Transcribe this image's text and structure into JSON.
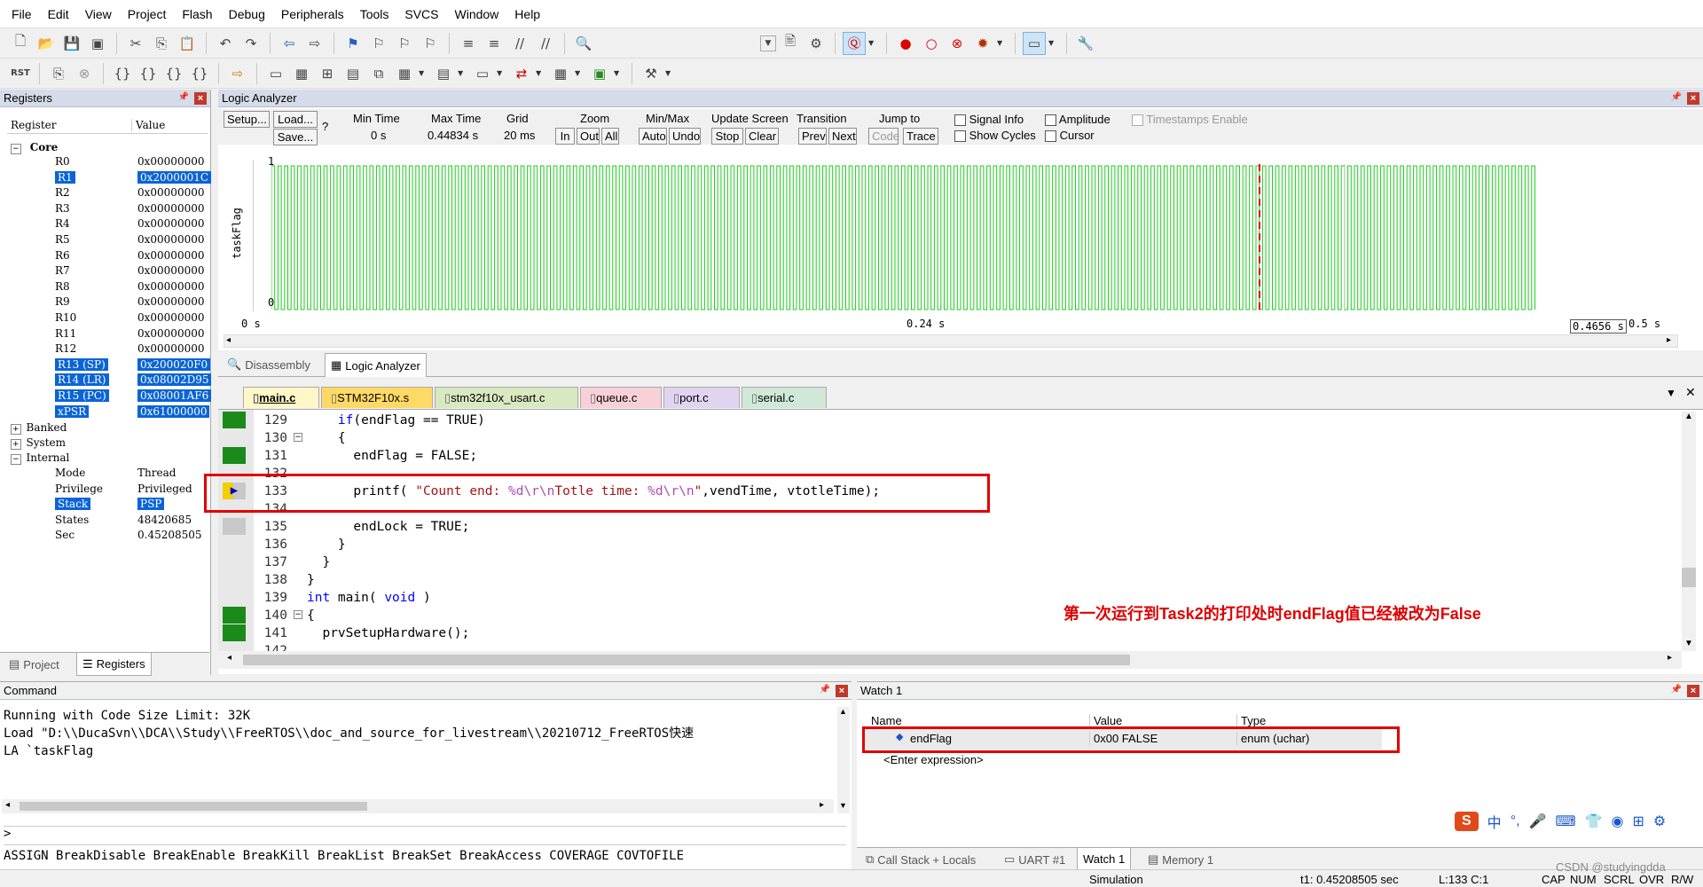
{
  "menu": [
    "File",
    "Edit",
    "View",
    "Project",
    "Flash",
    "Debug",
    "Peripherals",
    "Tools",
    "SVCS",
    "Window",
    "Help"
  ],
  "colors": {
    "accent": "#0a64d6",
    "signal": "#22cc22",
    "red_annotation": "#e00000",
    "panel_header": "#d6dbe9"
  },
  "registers_panel": {
    "title": "Registers",
    "col_register": "Register",
    "col_value": "Value",
    "core_label": "Core",
    "core": [
      {
        "name": "R0",
        "value": "0x00000000",
        "sel": false
      },
      {
        "name": "R1",
        "value": "0x2000001C",
        "sel": true
      },
      {
        "name": "R2",
        "value": "0x00000000",
        "sel": false
      },
      {
        "name": "R3",
        "value": "0x00000000",
        "sel": false
      },
      {
        "name": "R4",
        "value": "0x00000000",
        "sel": false
      },
      {
        "name": "R5",
        "value": "0x00000000",
        "sel": false
      },
      {
        "name": "R6",
        "value": "0x00000000",
        "sel": false
      },
      {
        "name": "R7",
        "value": "0x00000000",
        "sel": false
      },
      {
        "name": "R8",
        "value": "0x00000000",
        "sel": false
      },
      {
        "name": "R9",
        "value": "0x00000000",
        "sel": false
      },
      {
        "name": "R10",
        "value": "0x00000000",
        "sel": false
      },
      {
        "name": "R11",
        "value": "0x00000000",
        "sel": false
      },
      {
        "name": "R12",
        "value": "0x00000000",
        "sel": false
      },
      {
        "name": "R13 (SP)",
        "value": "0x200020F0",
        "sel": true
      },
      {
        "name": "R14 (LR)",
        "value": "0x08002D95",
        "sel": true
      },
      {
        "name": "R15 (PC)",
        "value": "0x08001AF6",
        "sel": true
      },
      {
        "name": "xPSR",
        "value": "0x61000000",
        "sel": true
      }
    ],
    "groups": [
      "Banked",
      "System",
      "Internal"
    ],
    "internal": [
      {
        "name": "Mode",
        "value": "Thread",
        "sel": false
      },
      {
        "name": "Privilege",
        "value": "Privileged",
        "sel": false
      },
      {
        "name": "Stack",
        "value": "PSP",
        "sel": true
      },
      {
        "name": "States",
        "value": "48420685",
        "sel": false
      },
      {
        "name": "Sec",
        "value": "0.45208505",
        "sel": false
      }
    ],
    "tabs": [
      "Project",
      "Registers"
    ]
  },
  "logic_analyzer": {
    "title": "Logic Analyzer",
    "setup": "Setup...",
    "load": "Load...",
    "save": "Save...",
    "help": "?",
    "min_time_label": "Min Time",
    "min_time": "0 s",
    "max_time_label": "Max Time",
    "max_time": "0.44834 s",
    "grid_label": "Grid",
    "grid": "20 ms",
    "zoom_label": "Zoom",
    "zoom_in": "In",
    "zoom_out": "Out",
    "zoom_all": "All",
    "minmax_label": "Min/Max",
    "auto": "Auto",
    "undo": "Undo",
    "update_label": "Update Screen",
    "stop": "Stop",
    "clear": "Clear",
    "transition_label": "Transition",
    "prev": "Prev",
    "next": "Next",
    "jump_label": "Jump to",
    "code": "Code",
    "trace": "Trace",
    "signal_info": "Signal Info",
    "show_cycles": "Show Cycles",
    "amplitude": "Amplitude",
    "cursor": "Cursor",
    "timestamps": "Timestamps Enable",
    "signal_name": "taskFlag",
    "y_high": "1",
    "y_low": "0",
    "t_start": "0 s",
    "t_mid": "0.24 s",
    "t_cursor": "0.4656 s",
    "t_end": "0.5 s"
  },
  "view_tabs": [
    "Disassembly",
    "Logic Analyzer"
  ],
  "editor": {
    "tabs": [
      {
        "label": "main.c",
        "color": "#fff7c8"
      },
      {
        "label": "STM32F10x.s",
        "color": "#ffd966"
      },
      {
        "label": "stm32f10x_usart.c",
        "color": "#d8e8c0"
      },
      {
        "label": "queue.c",
        "color": "#f8d0d8"
      },
      {
        "label": "port.c",
        "color": "#e0d4f0"
      },
      {
        "label": "serial.c",
        "color": "#d0e8d8"
      }
    ],
    "lines": [
      {
        "n": "129",
        "code": "    if(endFlag == TRUE)",
        "mark": "green"
      },
      {
        "n": "130",
        "code": "    {",
        "mark": "none"
      },
      {
        "n": "131",
        "code": "      endFlag = FALSE;",
        "mark": "green"
      },
      {
        "n": "132",
        "code": "",
        "mark": "none"
      },
      {
        "n": "133",
        "code": "      printf( \"Count end: %d\\r\\nTotle time: %d\\r\\n\",vendTime, vtotleTime);",
        "mark": "arrow"
      },
      {
        "n": "134",
        "code": "",
        "mark": "none"
      },
      {
        "n": "135",
        "code": "      endLock = TRUE;",
        "mark": "gray"
      },
      {
        "n": "136",
        "code": "    }",
        "mark": "none"
      },
      {
        "n": "137",
        "code": "  }",
        "mark": "none"
      },
      {
        "n": "138",
        "code": "}",
        "mark": "none"
      },
      {
        "n": "139",
        "code": "int main( void )",
        "mark": "none"
      },
      {
        "n": "140",
        "code": "{",
        "mark": "green"
      },
      {
        "n": "141",
        "code": "  prvSetupHardware();",
        "mark": "green"
      },
      {
        "n": "142",
        "code": "",
        "mark": "none"
      }
    ],
    "annotation": "第一次运行到Task2的打印处时endFlag值已经被改为False"
  },
  "command": {
    "title": "Command",
    "lines": [
      "Running with Code Size Limit: 32K",
      "Load \"D:\\\\DucaSvn\\\\DCA\\\\Study\\\\FreeRTOS\\\\doc_and_source_for_livestream\\\\20210712_FreeRTOS快速",
      "LA `taskFlag"
    ],
    "prompt": ">",
    "hints": "ASSIGN BreakDisable BreakEnable BreakKill BreakList BreakSet BreakAccess COVERAGE COVTOFILE"
  },
  "watch": {
    "title": "Watch 1",
    "col_name": "Name",
    "col_value": "Value",
    "col_type": "Type",
    "rows": [
      {
        "name": "endFlag",
        "value": "0x00 FALSE",
        "type": "enum (uchar)"
      }
    ],
    "enter_expression": "<Enter expression>",
    "tabs": [
      "Call Stack + Locals",
      "UART #1",
      "Watch 1",
      "Memory 1"
    ]
  },
  "ime": [
    "中",
    "°,"
  ],
  "status": {
    "mode": "Simulation",
    "t1": "t1: 0.45208505 sec",
    "pos": "L:133 C:1",
    "caps": "CAP",
    "num": "NUM",
    "scrl": "SCRL",
    "ovr": "OVR",
    "rw": "R/W",
    "watermark": "CSDN @studyingdda"
  }
}
